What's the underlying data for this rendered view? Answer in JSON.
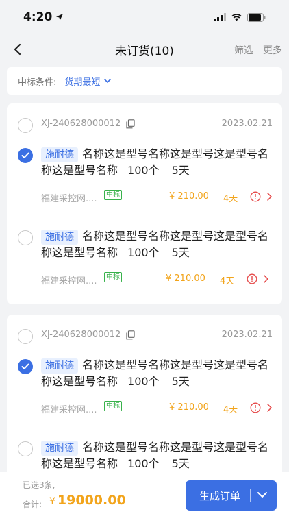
{
  "status_bar": {
    "time": "4:20"
  },
  "nav": {
    "title": "未订货(10)",
    "actions": [
      "筛选",
      "更多"
    ]
  },
  "filter": {
    "label": "中标条件:",
    "value": "货期最短"
  },
  "orders": [
    {
      "order_no": "XJ-240628000012",
      "date": "2023.02.21",
      "checked": false,
      "items": [
        {
          "brand": "施耐德",
          "name": "名称这是型号名称这是型号这是型号名称这是型号名称",
          "qty": "100个",
          "lead": "5天",
          "supplier": "福建采控网....",
          "bid_tag": "中标",
          "price": "¥ 210.00",
          "days": "4天",
          "checked": true
        },
        {
          "brand": "施耐德",
          "name": "名称这是型号名称这是型号这是型号名称这是型号名称",
          "qty": "100个",
          "lead": "5天",
          "supplier": "福建采控网....",
          "bid_tag": "中标",
          "price": "¥ 210.00",
          "days": "4天",
          "checked": false
        }
      ]
    },
    {
      "order_no": "XJ-240628000012",
      "date": "2023.02.21",
      "checked": false,
      "items": [
        {
          "brand": "施耐德",
          "name": "名称这是型号名称这是型号这是型号名称这是型号名称",
          "qty": "100个",
          "lead": "5天",
          "supplier": "福建采控网....",
          "bid_tag": "中标",
          "price": "¥ 210.00",
          "days": "4天",
          "checked": true
        },
        {
          "brand": "施耐德",
          "name": "名称这是型号名称这是型号这是型号名称这是型号名称",
          "qty": "100个",
          "lead": "5天",
          "checked": false
        }
      ]
    }
  ],
  "footer": {
    "selected": "已选3条,",
    "total_label": "合计:",
    "total_currency": "¥",
    "total_value": "19000.00",
    "button": "生成订单"
  },
  "colors": {
    "accent": "#3b6fe3",
    "price": "#f2a41b",
    "bid": "#38b24b",
    "alert": "#e54848"
  }
}
